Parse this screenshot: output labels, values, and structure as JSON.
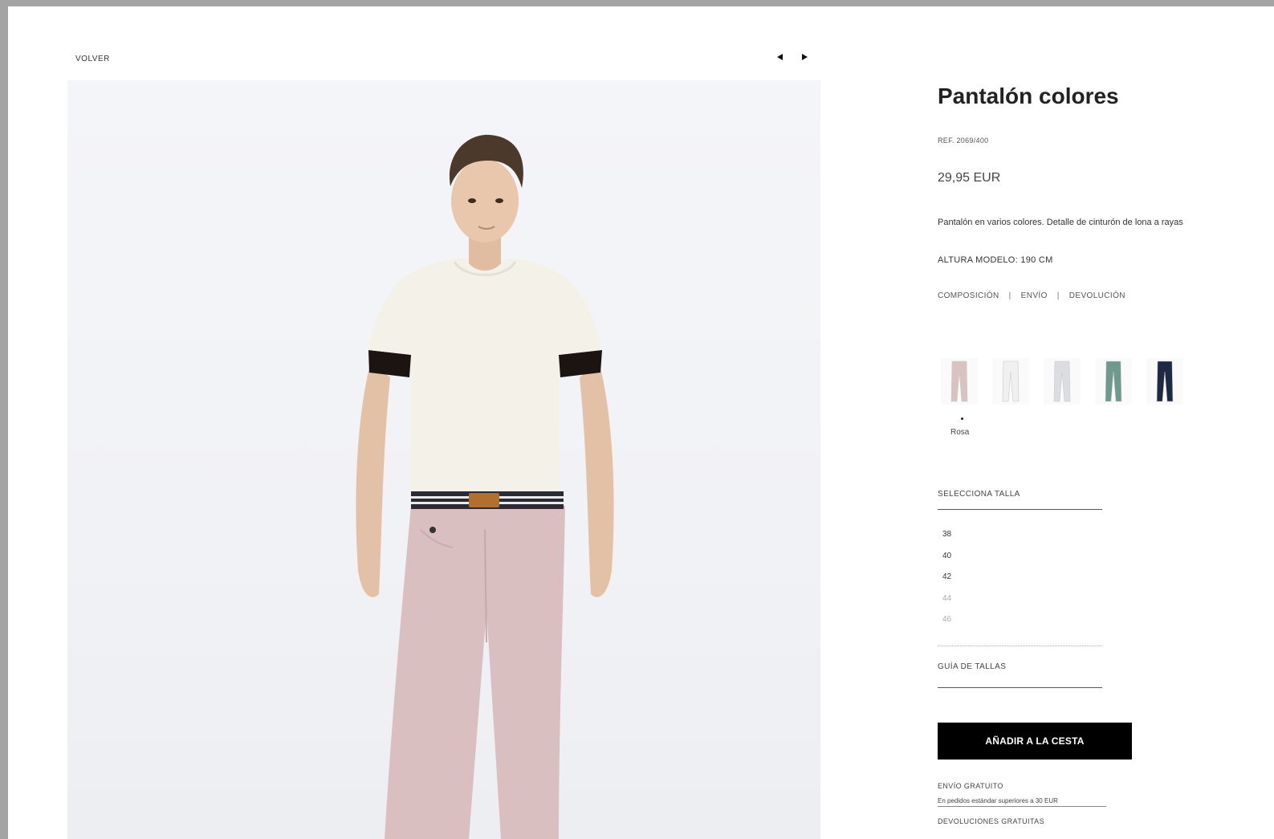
{
  "nav": {
    "back_label": "VOLVER"
  },
  "product": {
    "title": "Pantalón colores",
    "ref": "REF. 2069/400",
    "price": "29,95 EUR",
    "description": "Pantalón en varios colores. Detalle de cinturón de lona a rayas",
    "model_height": "ALTURA MODELO: 190 CM"
  },
  "info_links": {
    "composition": "COMPOSICIÓN",
    "shipping": "ENVÍO",
    "returns": "DEVOLUCIÓN",
    "separator": "|"
  },
  "colors": {
    "selected_name": "Rosa",
    "swatches": [
      {
        "name": "rosa",
        "hex": "#d9c3c1",
        "selected": true
      },
      {
        "name": "white",
        "hex": "#f0f0f0",
        "selected": false
      },
      {
        "name": "light-grey",
        "hex": "#dcdde0",
        "selected": false
      },
      {
        "name": "green",
        "hex": "#6d9a8c",
        "selected": false
      },
      {
        "name": "navy",
        "hex": "#1d2a44",
        "selected": false
      }
    ]
  },
  "sizes": {
    "label": "SELECCIONA TALLA",
    "options": [
      {
        "value": "38",
        "available": true
      },
      {
        "value": "40",
        "available": true
      },
      {
        "value": "42",
        "available": true
      },
      {
        "value": "44",
        "available": false
      },
      {
        "value": "46",
        "available": false
      }
    ],
    "guide_label": "GUÍA DE TALLAS"
  },
  "cart": {
    "add_label": "AÑADIR A LA CESTA"
  },
  "shipping": {
    "free_title": "ENVÍO GRATUITO",
    "free_text": "En pedidos estándar superiores a 30 EUR",
    "returns_title": "DEVOLUCIONES GRATUITAS"
  },
  "colors_theme": {
    "button_bg": "#000000",
    "page_bg": "#ffffff",
    "frame_bg": "#a4a4a4"
  }
}
